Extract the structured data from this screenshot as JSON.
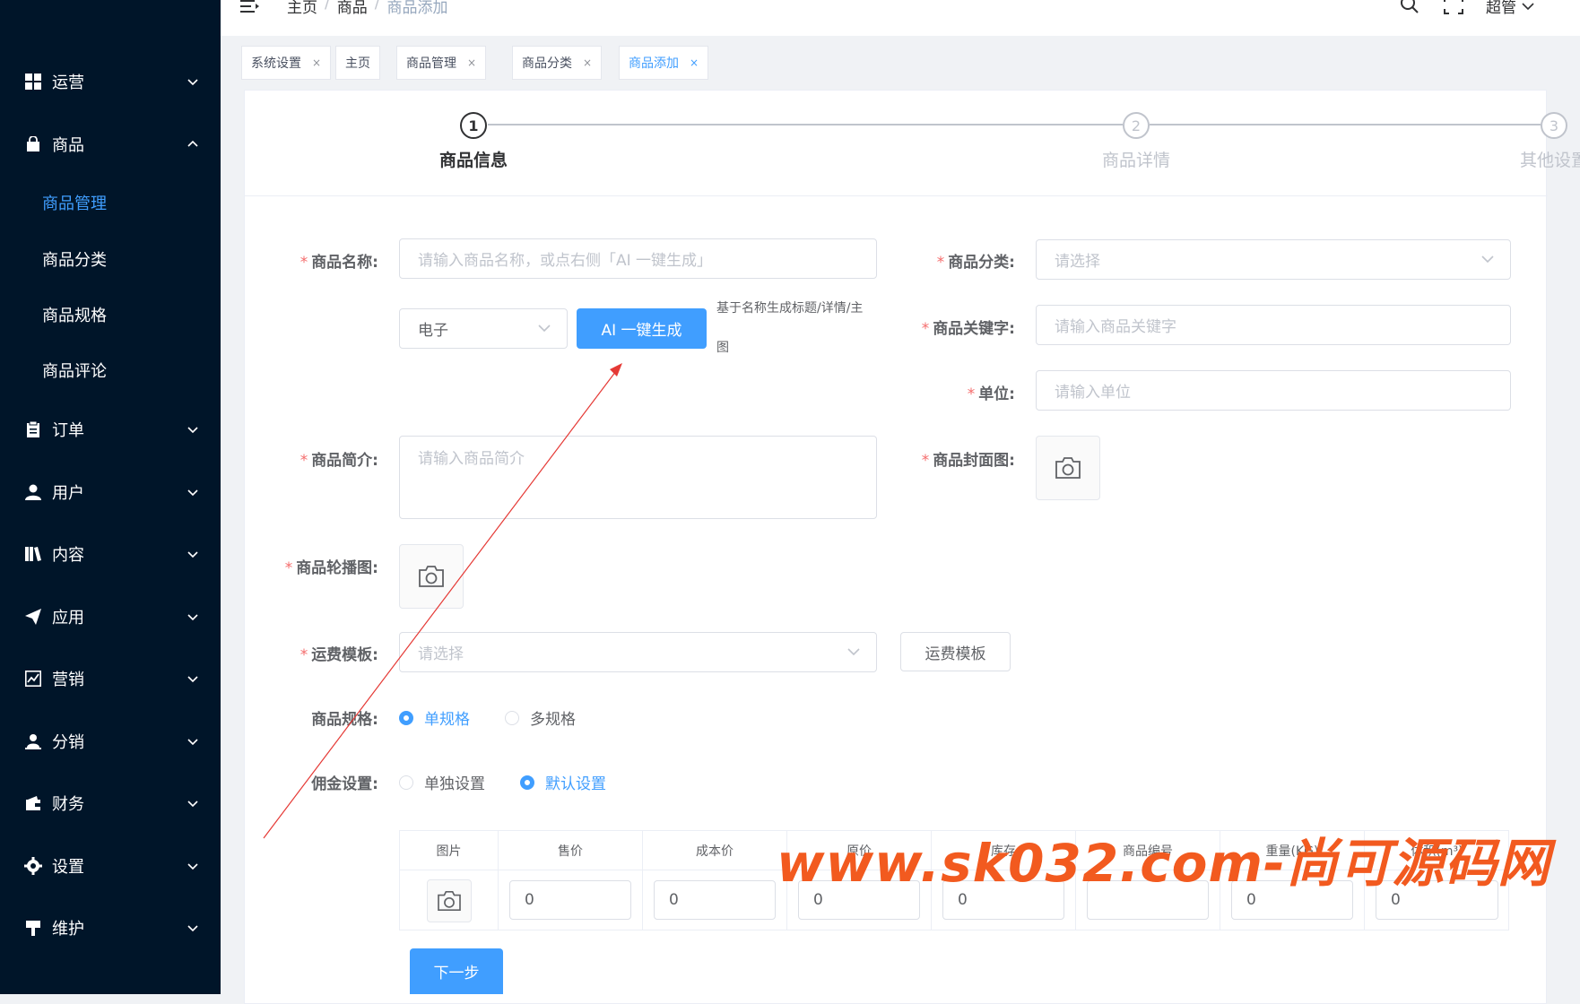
{
  "sidebar": {
    "items": [
      {
        "label": "运营",
        "icon": "grid-icon"
      },
      {
        "label": "商品",
        "icon": "shopping-bag-icon",
        "expanded": true
      },
      {
        "label": "订单",
        "icon": "clipboard-icon"
      },
      {
        "label": "用户",
        "icon": "user-icon"
      },
      {
        "label": "内容",
        "icon": "book-icon"
      },
      {
        "label": "应用",
        "icon": "paper-plane-icon"
      },
      {
        "label": "营销",
        "icon": "chart-icon"
      },
      {
        "label": "分销",
        "icon": "user-stand-icon"
      },
      {
        "label": "财务",
        "icon": "wallet-icon"
      },
      {
        "label": "设置",
        "icon": "gear-icon"
      },
      {
        "label": "维护",
        "icon": "sign-icon"
      }
    ],
    "sub_items": [
      {
        "label": "商品管理",
        "active": true
      },
      {
        "label": "商品分类"
      },
      {
        "label": "商品规格"
      },
      {
        "label": "商品评论"
      }
    ]
  },
  "header": {
    "breadcrumb": [
      "主页",
      "商品",
      "商品添加"
    ],
    "user": "超管"
  },
  "tags": [
    {
      "label": "系统设置",
      "closable": true
    },
    {
      "label": "主页",
      "closable": false
    },
    {
      "label": "商品管理",
      "closable": true
    },
    {
      "label": "商品分类",
      "closable": true
    },
    {
      "label": "商品添加",
      "closable": true,
      "active": true
    }
  ],
  "steps": [
    {
      "num": "1",
      "label": "商品信息",
      "active": true
    },
    {
      "num": "2",
      "label": "商品详情"
    },
    {
      "num": "3",
      "label": "其他设置"
    }
  ],
  "form": {
    "name_label": "商品名称:",
    "name_placeholder": "请输入商品名称，或点右侧「AI 一键生成」",
    "type_value": "电子",
    "ai_button": "AI 一键生成",
    "ai_hint_1": "基于名称生成标题/详情/主",
    "ai_hint_2": "图",
    "category_label": "商品分类:",
    "category_placeholder": "请选择",
    "keyword_label": "商品关键字:",
    "keyword_placeholder": "请输入商品关键字",
    "unit_label": "单位:",
    "unit_placeholder": "请输入单位",
    "intro_label": "商品简介:",
    "intro_placeholder": "请输入商品简介",
    "cover_label": "商品封面图:",
    "carousel_label": "商品轮播图:",
    "freight_label": "运费模板:",
    "freight_placeholder": "请选择",
    "freight_button": "运费模板",
    "spec_label": "商品规格:",
    "spec_single": "单规格",
    "spec_multi": "多规格",
    "commission_label": "佣金设置:",
    "commission_single": "单独设置",
    "commission_default": "默认设置",
    "next_button": "下一步"
  },
  "sku_table": {
    "columns": [
      "图片",
      "售价",
      "成本价",
      "原价",
      "库存",
      "商品编号",
      "重量(KG)",
      "体积(m³)"
    ],
    "values": [
      "0",
      "0",
      "0",
      "0",
      "",
      "0",
      "0"
    ]
  },
  "watermark": "www.sk032.com-尚可源码网",
  "colors": {
    "sidebar": "#001529",
    "primary": "#409eff",
    "required": "#f56c6c",
    "watermark": "#f25a1f"
  }
}
